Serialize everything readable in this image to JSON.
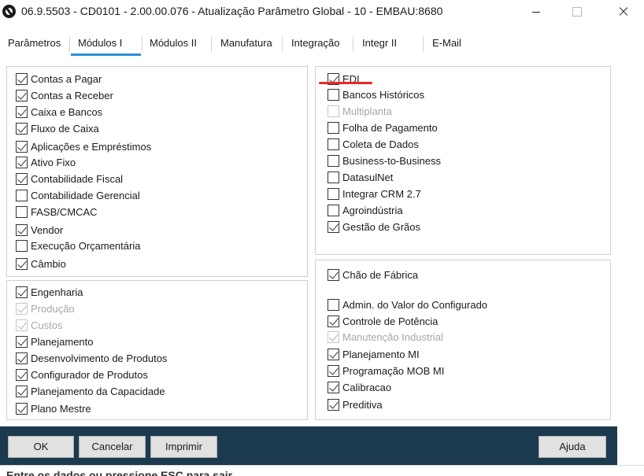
{
  "window": {
    "title": "06.9.5503 - CD0101 - 2.00.00.076 - Atualização Parâmetro Global - 10 - EMBAU:8680"
  },
  "tabs": [
    {
      "label": "Parâmetros",
      "active": false
    },
    {
      "label": "Módulos I",
      "active": true
    },
    {
      "label": "Módulos II",
      "active": false
    },
    {
      "label": "Manufatura",
      "active": false
    },
    {
      "label": "Integração",
      "active": false
    },
    {
      "label": "Integr II",
      "active": false
    },
    {
      "label": "E-Mail",
      "active": false
    }
  ],
  "groups": {
    "financeiro": [
      {
        "label": "Contas a Pagar",
        "checked": true,
        "enabled": true
      },
      {
        "label": "Contas a Receber",
        "checked": true,
        "enabled": true
      },
      {
        "label": "Caixa e Bancos",
        "checked": true,
        "enabled": true
      },
      {
        "label": "Fluxo de Caixa",
        "checked": true,
        "enabled": true
      },
      {
        "label": "Aplicações e Empréstimos",
        "checked": true,
        "enabled": true
      },
      {
        "label": "Ativo Fixo",
        "checked": true,
        "enabled": true
      },
      {
        "label": "Contabilidade Fiscal",
        "checked": true,
        "enabled": true
      },
      {
        "label": "Contabilidade Gerencial",
        "checked": false,
        "enabled": true
      },
      {
        "label": "FASB/CMCAC",
        "checked": false,
        "enabled": true
      },
      {
        "label": "Vendor",
        "checked": true,
        "enabled": true
      },
      {
        "label": "Execução Orçamentária",
        "checked": false,
        "enabled": true
      },
      {
        "label": "Câmbio",
        "checked": true,
        "enabled": true
      }
    ],
    "engenharia": [
      {
        "label": "Engenharia",
        "checked": true,
        "enabled": true
      },
      {
        "label": "Produção",
        "checked": true,
        "enabled": false
      },
      {
        "label": "Custos",
        "checked": true,
        "enabled": false
      },
      {
        "label": "Planejamento",
        "checked": true,
        "enabled": true
      },
      {
        "label": "Desenvolvimento de Produtos",
        "checked": true,
        "enabled": true
      },
      {
        "label": "Configurador de Produtos",
        "checked": true,
        "enabled": true
      },
      {
        "label": "Planejamento da Capacidade",
        "checked": true,
        "enabled": true
      },
      {
        "label": "Plano Mestre",
        "checked": true,
        "enabled": true
      }
    ],
    "integracao": [
      {
        "label": "EDI",
        "checked": true,
        "enabled": true
      },
      {
        "label": "Bancos Históricos",
        "checked": false,
        "enabled": true
      },
      {
        "label": "Multiplanta",
        "checked": false,
        "enabled": false
      },
      {
        "label": "Folha de Pagamento",
        "checked": false,
        "enabled": true
      },
      {
        "label": "Coleta de Dados",
        "checked": false,
        "enabled": true
      },
      {
        "label": "Business-to-Business",
        "checked": false,
        "enabled": true
      },
      {
        "label": "DatasulNet",
        "checked": false,
        "enabled": true
      },
      {
        "label": "Integrar CRM 2.7",
        "checked": false,
        "enabled": true
      },
      {
        "label": "Agroindústria",
        "checked": false,
        "enabled": true
      },
      {
        "label": "Gestão de Grãos",
        "checked": true,
        "enabled": true
      }
    ],
    "chao_fabrica_header": {
      "label": "Chão de Fábrica",
      "checked": true,
      "enabled": true
    },
    "chao_fabrica": [
      {
        "label": "Admin. do Valor do Configurado",
        "checked": false,
        "enabled": true
      },
      {
        "label": "Controle de Potência",
        "checked": true,
        "enabled": true
      },
      {
        "label": "Manutenção Industrial",
        "checked": true,
        "enabled": false
      },
      {
        "label": "Planejamento MI",
        "checked": true,
        "enabled": true
      },
      {
        "label": "Programação MOB MI",
        "checked": true,
        "enabled": true
      },
      {
        "label": "Calibracao",
        "checked": true,
        "enabled": true
      },
      {
        "label": "Preditiva",
        "checked": true,
        "enabled": true
      }
    ]
  },
  "buttons": {
    "ok": "OK",
    "cancel": "Cancelar",
    "print": "Imprimir",
    "help": "Ajuda"
  },
  "status": {
    "text": "Entre os dados ou pressione ESC para sair."
  },
  "colors": {
    "button_bar": "#1c3a4e",
    "active_tab_underline": "#2b8fd6",
    "annotation": "#e8282b"
  }
}
